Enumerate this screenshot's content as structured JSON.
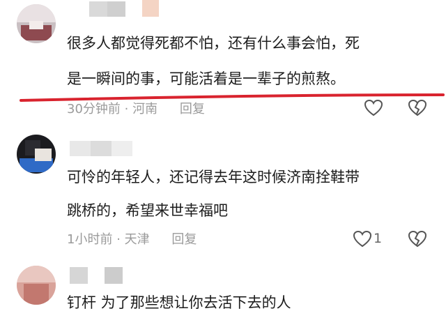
{
  "comments": [
    {
      "text_lines": [
        "很多人都觉得死都不怕，还有什么事会怕，死",
        "是一瞬间的事，可能活着是一辈子的煎熬。"
      ],
      "time": "30分钟前",
      "location": "河南",
      "reply_label": "回复"
    },
    {
      "text_lines": [
        "可怜的年轻人，还记得去年这时候济南拴鞋带",
        "跳桥的，希望来世幸福吧"
      ],
      "time": "1小时前",
      "location": "天津",
      "reply_label": "回复",
      "like_count": "1"
    },
    {
      "text_lines": [
        "钉杆 为了那些想让你去活下去的人"
      ]
    }
  ],
  "icons": [
    "heart-icon",
    "broken-heart-icon"
  ],
  "colors": {
    "annotation_line": "#d9232e",
    "meta_text": "#9a9a9a",
    "body_text": "#1c1c1c"
  }
}
